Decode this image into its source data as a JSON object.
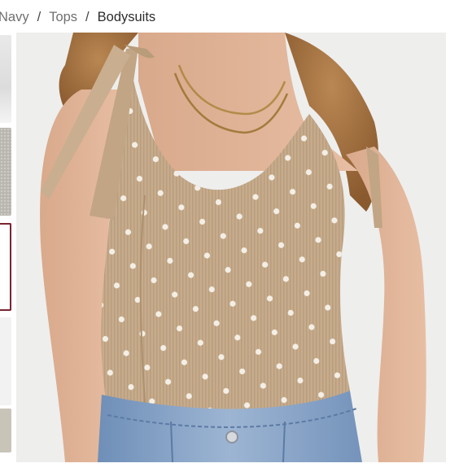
{
  "breadcrumb": {
    "items": [
      "Navy",
      "Tops"
    ],
    "separator": "/",
    "current": "Bodysuits"
  },
  "gallery": {
    "thumbnails": [
      "thumbnail-1",
      "thumbnail-2",
      "thumbnail-3",
      "thumbnail-4",
      "thumbnail-5"
    ],
    "selected_index": 2,
    "selected_border_color": "#7b2431",
    "main_image_description": "model wearing beige polka-dot ribbed bodysuit with tie straps and jeans"
  },
  "colors": {
    "background": "#ffffff",
    "breadcrumb_link": "#6f6f6f",
    "breadcrumb_current": "#2d2d2d",
    "fabric": "#c6ab8c",
    "denim": "#7f9cc1"
  }
}
